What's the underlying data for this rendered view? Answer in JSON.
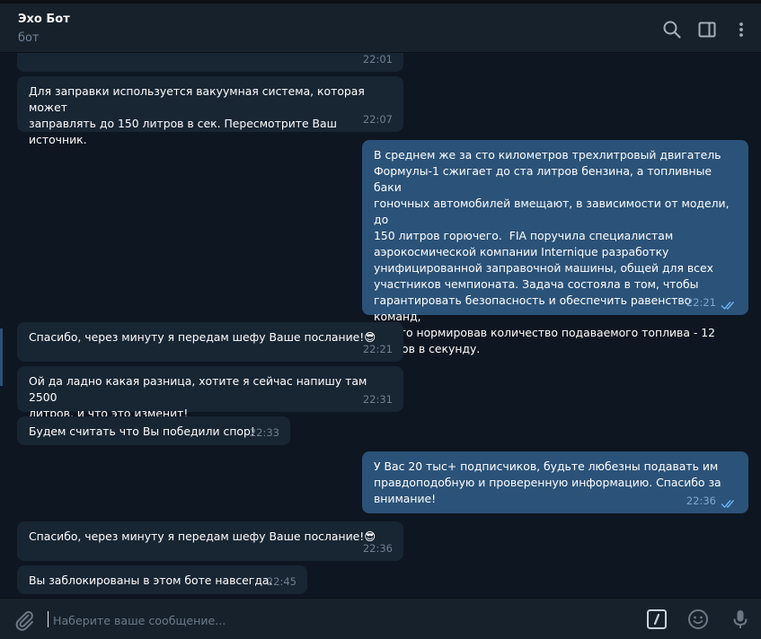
{
  "header": {
    "title": "Эхо Бот",
    "subtitle": "бот",
    "icons": [
      "search-icon",
      "sidebar-toggle-icon",
      "more-vertical-icon"
    ]
  },
  "messages": [
    {
      "direction": "in",
      "text": "",
      "time": "22:01"
    },
    {
      "direction": "in",
      "text": "Для заправки используется вакуумная система, которая может\nзаправлять до 150 литров в сек. Пересмотрите Ваш источник.",
      "time": "22:07"
    },
    {
      "direction": "out",
      "text": "В среднем же за сто километров трехлитровый двигатель\nФормулы-1 сжигает до ста литров бензина, а топливные баки\nгоночных автомобилей вмещают, в зависимости от модели, до\n150 литров горючего.  FIA поручила специалистам\nаэрокосмической компании Interniquе разработку\nунифицированной заправочной машины, общей для всех\nучастников чемпионата. Задача состояла в том, чтобы\nгарантировать безопасность и обеспечить равенство команд,\nстрого нормировав количество подаваемого топлива - 12\nлитров в секунду.",
      "time": "22:21",
      "read": true
    },
    {
      "direction": "in",
      "text": "Спасибо, через минуту я передам шефу Ваше послание!😎",
      "time": "22:21"
    },
    {
      "direction": "in",
      "text": "Ой да ладно какая разница, хотите я сейчас напишу там 2500\nлитров, и что это изменит!",
      "time": "22:31"
    },
    {
      "direction": "in",
      "text": "Будем считать что Вы победили спор!",
      "time": "22:33"
    },
    {
      "direction": "out",
      "text": "У Вас 20 тыс+ подписчиков, будьте любезны подавать им\nправдоподобную и проверенную информацию. Спасибо за\nвнимание!",
      "time": "22:36",
      "read": true
    },
    {
      "direction": "in",
      "text": "Спасибо, через минуту я передам шефу Ваше послание!😎",
      "time": "22:36"
    },
    {
      "direction": "in",
      "text": "Вы заблокированы в этом боте навсегда.",
      "time": "22:45"
    }
  ],
  "composer": {
    "placeholder": "Наберите ваше сообщение...",
    "value": "",
    "icons": [
      "paperclip-icon",
      "bot-commands-icon",
      "emoji-icon",
      "microphone-icon"
    ]
  },
  "colors": {
    "background": "#0e1621",
    "header": "#17212b",
    "incoming_bubble": "#182533",
    "outgoing_bubble": "#2b5278",
    "read_checks": "#6ab3f3",
    "muted_text": "#708499"
  }
}
